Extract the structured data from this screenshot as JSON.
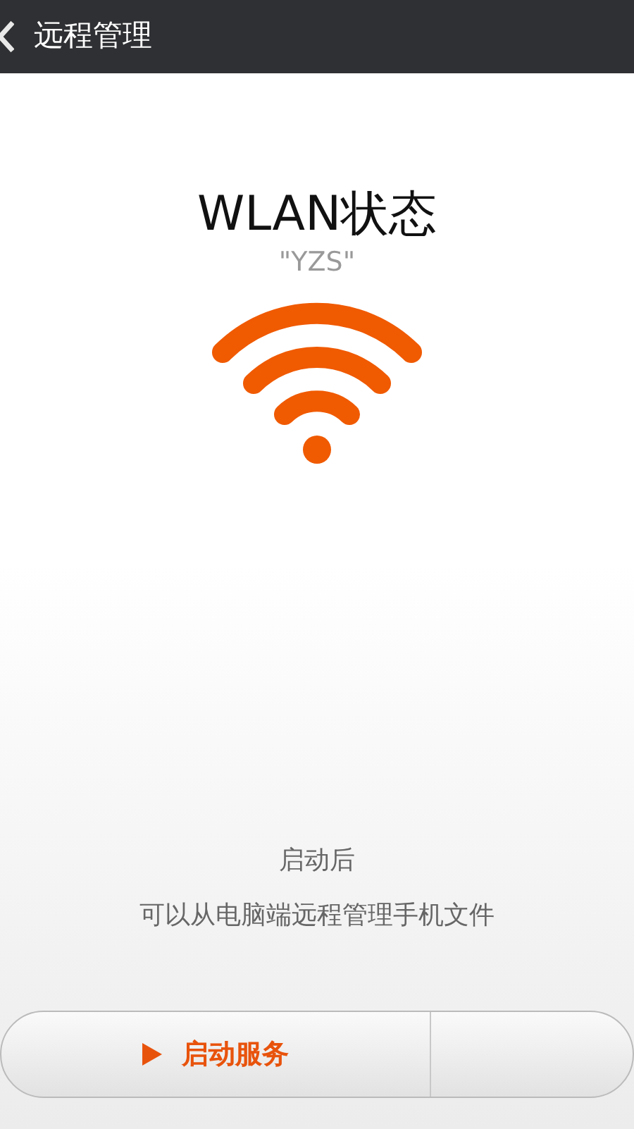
{
  "header": {
    "title": "远程管理"
  },
  "status": {
    "title": "WLAN状态",
    "network": "\"YZS\""
  },
  "hint": {
    "lines": [
      "启动后",
      "可以从电脑端远程管理手机文件"
    ]
  },
  "buttons": [
    {
      "label": "启动服务"
    }
  ]
}
